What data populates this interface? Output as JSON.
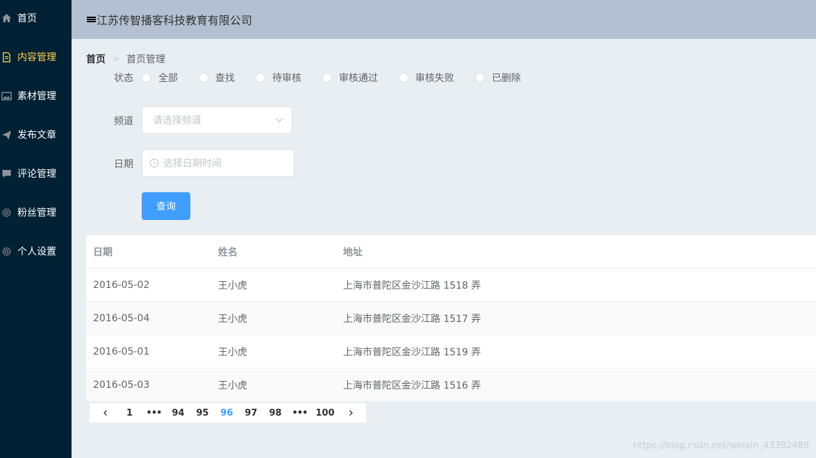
{
  "sidebar": {
    "items": [
      {
        "label": "首页",
        "icon": "home-icon"
      },
      {
        "label": "内容管理",
        "icon": "document-icon",
        "active": true
      },
      {
        "label": "素材管理",
        "icon": "image-icon"
      },
      {
        "label": "发布文章",
        "icon": "send-icon"
      },
      {
        "label": "评论管理",
        "icon": "comment-icon"
      },
      {
        "label": "粉丝管理",
        "icon": "gear-icon"
      },
      {
        "label": "个人设置",
        "icon": "gear-icon"
      }
    ]
  },
  "header": {
    "title": "江苏传智播客科技教育有限公司"
  },
  "breadcrumb": {
    "home": "首页",
    "current": "首页管理"
  },
  "form": {
    "status_label": "状态",
    "status_options": [
      "全部",
      "查找",
      "待审核",
      "审核通过",
      "审核失败",
      "已删除"
    ],
    "channel_label": "频道",
    "channel_placeholder": "请选择频道",
    "date_label": "日期",
    "date_placeholder": "选择日期时间",
    "query_button": "查询"
  },
  "table": {
    "columns": [
      "日期",
      "姓名",
      "地址"
    ],
    "rows": [
      [
        "2016-05-02",
        "王小虎",
        "上海市普陀区金沙江路 1518 弄"
      ],
      [
        "2016-05-04",
        "王小虎",
        "上海市普陀区金沙江路 1517 弄"
      ],
      [
        "2016-05-01",
        "王小虎",
        "上海市普陀区金沙江路 1519 弄"
      ],
      [
        "2016-05-03",
        "王小虎",
        "上海市普陀区金沙江路 1516 弄"
      ]
    ]
  },
  "pagination": {
    "pages": [
      "1",
      "•••",
      "94",
      "95",
      "96",
      "97",
      "98",
      "•••",
      "100"
    ],
    "current": "96"
  },
  "watermark": "https://blog.csdn.net/weixin_43392489",
  "colors": {
    "sidebar_bg": "#002033",
    "active_menu": "#ffd04b",
    "header_bg": "#b3c0d1",
    "primary": "#409eff",
    "main_bg": "#e9eef3"
  }
}
